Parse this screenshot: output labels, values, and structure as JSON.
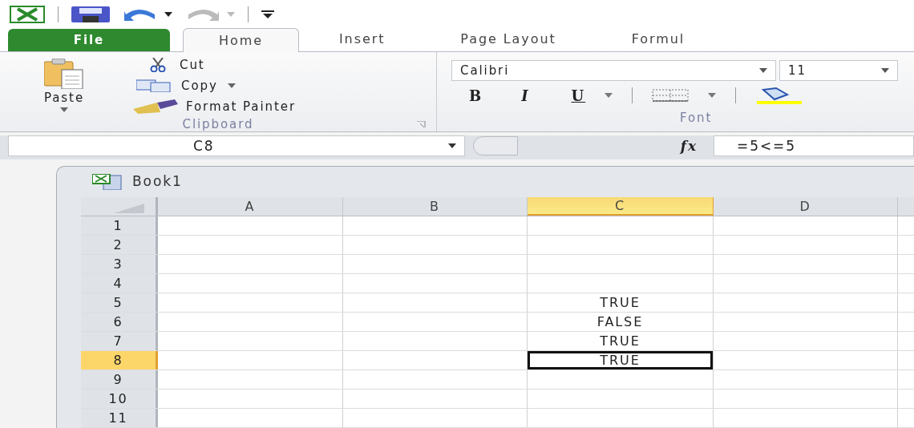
{
  "quick_access": {
    "redo_disabled": true
  },
  "tabs": [
    {
      "label": "File",
      "kind": "file",
      "selected": false
    },
    {
      "label": "Home",
      "kind": "tab",
      "selected": true
    },
    {
      "label": "Insert",
      "kind": "tab",
      "selected": false
    },
    {
      "label": "Page Layout",
      "kind": "tab",
      "selected": false
    },
    {
      "label": "Formul",
      "kind": "tab",
      "selected": false
    }
  ],
  "clipboard": {
    "paste": "Paste",
    "cut": "Cut",
    "copy": "Copy",
    "format_painter": "Format Painter",
    "label": "Clipboard"
  },
  "font": {
    "font_name": "Calibri",
    "font_size": "11",
    "bold": "B",
    "italic": "I",
    "underline": "U",
    "label": "Font"
  },
  "formula_bar": {
    "name_box": "C8",
    "fx": "fx",
    "formula": "=5<=5"
  },
  "workbook": {
    "title": "Book1",
    "columns": [
      {
        "label": "A",
        "selected": false
      },
      {
        "label": "B",
        "selected": false
      },
      {
        "label": "C",
        "selected": true
      },
      {
        "label": "D",
        "selected": false
      }
    ],
    "rows": [
      {
        "label": "1",
        "selected": false,
        "cells": [
          {},
          {},
          {},
          {}
        ]
      },
      {
        "label": "2",
        "selected": false,
        "cells": [
          {},
          {},
          {},
          {}
        ]
      },
      {
        "label": "3",
        "selected": false,
        "cells": [
          {},
          {},
          {},
          {}
        ]
      },
      {
        "label": "4",
        "selected": false,
        "cells": [
          {},
          {},
          {},
          {}
        ]
      },
      {
        "label": "5",
        "selected": false,
        "cells": [
          {},
          {},
          {
            "text": "TRUE"
          },
          {}
        ]
      },
      {
        "label": "6",
        "selected": false,
        "cells": [
          {},
          {},
          {
            "text": "FALSE"
          },
          {}
        ]
      },
      {
        "label": "7",
        "selected": false,
        "cells": [
          {},
          {},
          {
            "text": "TRUE"
          },
          {}
        ]
      },
      {
        "label": "8",
        "selected": true,
        "cells": [
          {},
          {},
          {
            "text": "TRUE",
            "selected": true
          },
          {}
        ]
      },
      {
        "label": "9",
        "selected": false,
        "cells": [
          {},
          {},
          {},
          {}
        ]
      },
      {
        "label": "10",
        "selected": false,
        "cells": [
          {},
          {},
          {},
          {}
        ]
      },
      {
        "label": "11",
        "selected": false,
        "cells": [
          {},
          {},
          {},
          {}
        ]
      }
    ]
  }
}
